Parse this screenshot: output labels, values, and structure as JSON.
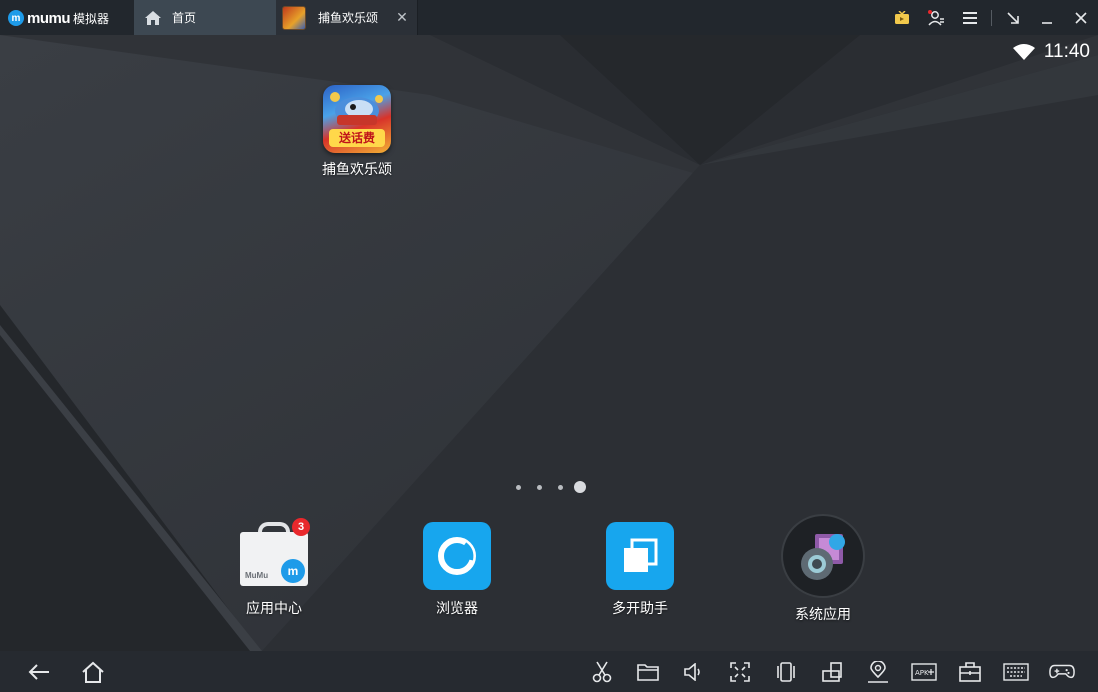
{
  "app": {
    "logo_text": "mumu",
    "logo_sub": "模拟器"
  },
  "tabs": [
    {
      "label": "首页",
      "icon": "home-icon",
      "active": true
    },
    {
      "label": "捕鱼欢乐颂",
      "icon": "game-thumbnail",
      "active": false
    }
  ],
  "title_controls": [
    "tv-icon",
    "user-icon",
    "menu-icon",
    "minimize-to-tray-icon",
    "minimize-icon",
    "close-icon"
  ],
  "status": {
    "time": "11:40",
    "wifi": "wifi-icon"
  },
  "desktop_apps": [
    {
      "label": "捕鱼欢乐颂",
      "badge_text": "送话费"
    }
  ],
  "page_dots": {
    "count": 4,
    "active_index": 3
  },
  "dock": [
    {
      "label": "应用中心",
      "badge": "3",
      "store_text": "MuMu",
      "icon": "app-center-icon"
    },
    {
      "label": "浏览器",
      "icon": "browser-icon"
    },
    {
      "label": "多开助手",
      "icon": "multi-instance-icon"
    },
    {
      "label": "系统应用",
      "icon": "system-apps-icon"
    }
  ],
  "navbar": {
    "left": [
      "back-icon",
      "home-icon"
    ],
    "right": [
      "scissors-icon",
      "folder-icon",
      "volume-icon",
      "fullscreen-icon",
      "shake-icon",
      "rotate-icon",
      "location-icon",
      "apk-install-icon",
      "toolbox-icon",
      "keyboard-icon",
      "gamepad-icon"
    ]
  },
  "colors": {
    "accent": "#1e9be9",
    "titlebar": "#22272d",
    "tab_active": "#3d4852",
    "badge_red": "#e8282c"
  }
}
